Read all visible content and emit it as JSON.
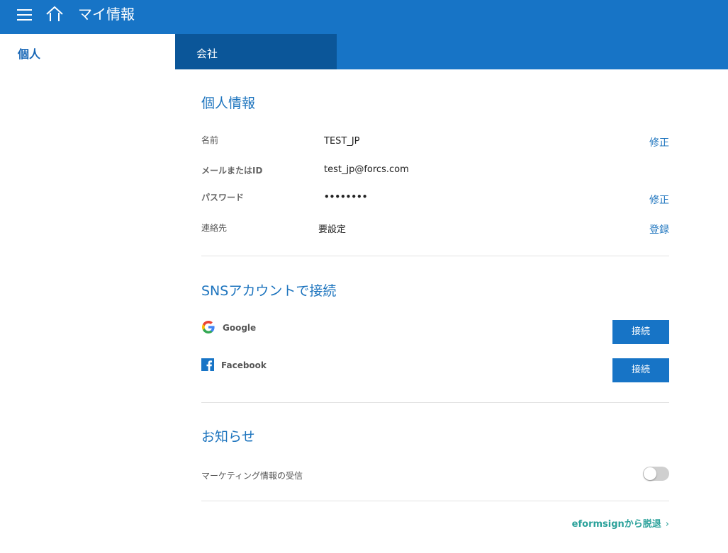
{
  "header": {
    "title": "マイ情報",
    "menu_icon": "hamburger-menu-icon",
    "home_icon": "home-icon",
    "bar_color": "#1774c6"
  },
  "tabs": [
    {
      "label": "個人",
      "active": true
    },
    {
      "label": "会社",
      "active": false
    }
  ],
  "personal_info": {
    "title": "個人情報",
    "rows": [
      {
        "label": "名前",
        "value": "TEST_JP",
        "action": "修正"
      },
      {
        "label": "メールまたはID",
        "value": "test_jp@forcs.com",
        "action": ""
      },
      {
        "label": "パスワード",
        "value": "••••••••",
        "action": "修正"
      },
      {
        "label": "連絡先",
        "value": "要設定",
        "action": "登録"
      }
    ]
  },
  "sns": {
    "title": "SNSアカウントで接続",
    "items": [
      {
        "name": "Google",
        "icon": "google-logo-icon",
        "button": "接続"
      },
      {
        "name": "Facebook",
        "icon": "facebook-logo-icon",
        "button": "接続"
      }
    ]
  },
  "notifications": {
    "title": "お知らせ",
    "marketing_label": "マーケティング情報の受信",
    "marketing_enabled": false
  },
  "withdraw": {
    "label": "eformsignから脱退",
    "icon": "chevron-right-icon"
  },
  "colors": {
    "primary": "#1774c6",
    "active_tab_dark": "#0b5699",
    "link": "#1d74be",
    "withdraw": "#2aa19a"
  }
}
